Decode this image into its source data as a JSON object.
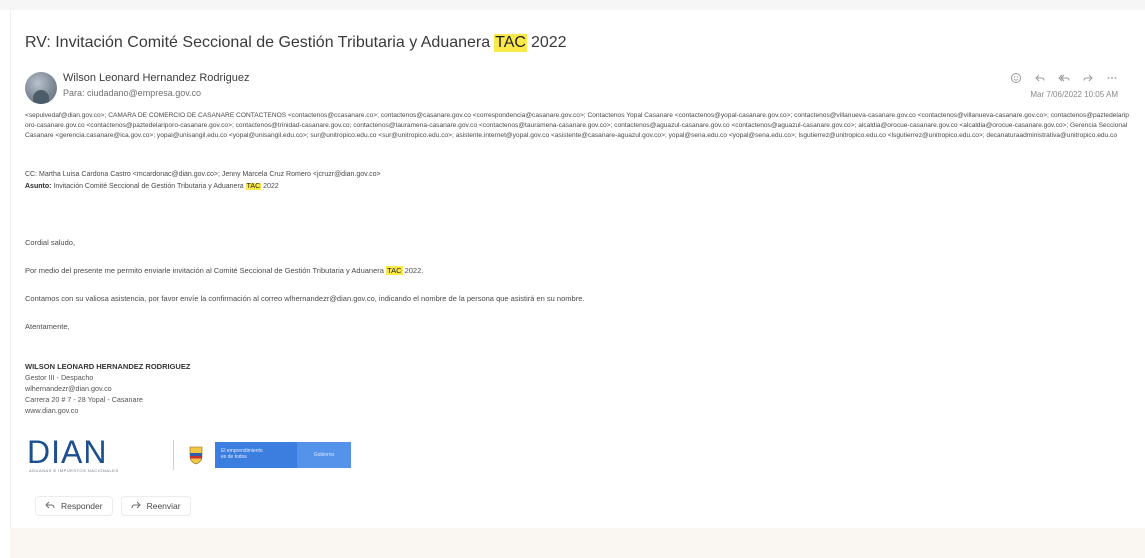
{
  "email": {
    "subject_prefix": "RV: Invitación Comité Seccional de Gestión Tributaria y Aduanera",
    "subject_highlight": "TAC",
    "subject_suffix": "2022",
    "sender_name": "Wilson Leonard Hernandez Rodriguez",
    "sender_to": "Para: ciudadano@empresa.gov.co",
    "datetime": "Mar 7/06/2022 10:05 AM",
    "recipients_text": "<sepulvedaf@dian.gov.co>; CAMARA DE COMERCIO DE CASANARE CONTACTENOS <contactenos@ccasanare.co>; contactenos@casanare.gov.co <correspondencia@casanare.gov.co>; Contactenos Yopal Casanare <contactenos@yopal-casanare.gov.co>; contactenos@villanueva-casanare.gov.co <contactenos@villanueva-casanare.gov.co>; contactenos@paztedelariporo-casanare.gov.co <contactenos@paztedelariporo-casanare.gov.co>; contactenos@trinidad-casanare.gov.co; contactenos@tauramena-casanare.gov.co <contactenos@tauramena-casanare.gov.co>; contactenos@aguazul-casanare.gov.co <contactenos@aguazul-casanare.gov.co>; alcaldia@orocue-casanare.gov.co <alcaldia@orocue-casanare.gov.co>; Gerencia Seccional Casanare <gerencia.casanare@ica.gov.co>; yopal@unisangil.edu.co <yopal@unisangil.edu.co>; sur@unitropico.edu.co <sur@unitropico.edu.co>; asistente.internet@yopal.gov.co <asistente@casanare-aguazul.gov.co>; yopal@sena.edu.co <yopal@sena.edu.co>; lsgutierrez@unitropico.edu.co <lsgutierrez@unitropico.edu.co>; decanaturaadministrativa@unitropico.edu.co",
    "cc_text": "CC: Martha Luisa Cardona Castro <mcardonac@dian.gov.co>; Jenny Marcela Cruz Romero <jcruzr@dian.gov.co>",
    "subject_label": "Asunto:",
    "subject_line_prefix": "Invitación Comité Seccional de Gestión Tributaria y Aduanera",
    "subject_line_highlight": "TAC",
    "subject_line_suffix": "2022",
    "greeting": "Cordial saludo,",
    "body_prefix": "Por medio del presente me permito enviarle invitación al Comité Seccional de Gestión Tributaria y Aduanera",
    "body_highlight": "TAC",
    "body_suffix": "2022.",
    "body_confirm": "Contamos con su valiosa asistencia, por favor envíe la confirmación al correo wlhernandezr@dian.gov.co, indicando el nombre de la persona que asistirá en su nombre.",
    "closing": "Atentamente,",
    "signature": {
      "name": "WILSON LEONARD HERNANDEZ RODRIGUEZ",
      "role": "Gestor III - Despacho",
      "email": "wlhernandezr@dian.gov.co",
      "address": "Carrera 20 # 7 - 28 Yopal - Casanare",
      "web": "www.dian.gov.co"
    },
    "logo": {
      "mark": "DIAN",
      "tagline": "ADUANAS E IMPUESTOS NACIONALES",
      "gov_left": "El emprendimiento\nes de todos",
      "gov_right": "Gobierno"
    },
    "buttons": {
      "reply": "Responder",
      "forward": "Reenviar"
    }
  },
  "colors": {
    "highlight": "#fbe94a",
    "dian_blue": "#1b4f8f",
    "gov_blue": "#3c7de0"
  }
}
